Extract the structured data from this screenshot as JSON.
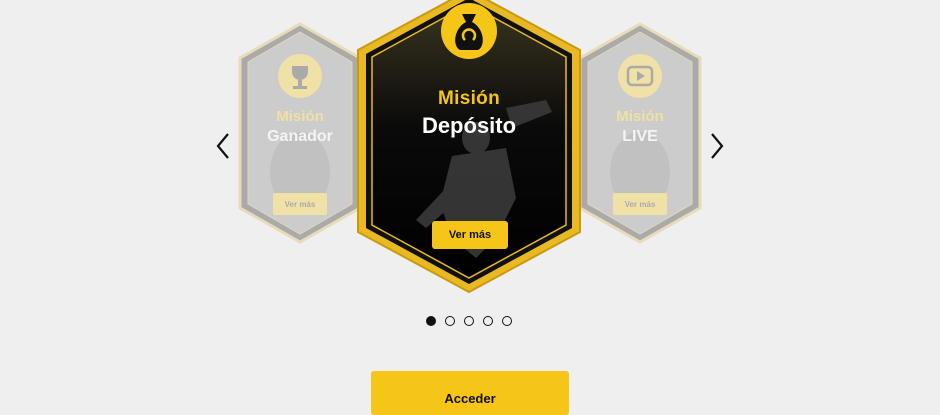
{
  "carousel": {
    "prev_label": "Previous",
    "next_label": "Next",
    "cards": [
      {
        "title_line1": "Misión",
        "title_line2": "Ganador",
        "button_label": "Ver más",
        "icon": "trophy-icon"
      },
      {
        "title_line1": "Misión",
        "title_line2": "Depósito",
        "button_label": "Ver más",
        "icon": "money-bag-icon"
      },
      {
        "title_line1": "Misión",
        "title_line2": "LIVE",
        "button_label": "Ver más",
        "icon": "play-icon"
      }
    ],
    "dots_total": 5,
    "active_dot": 1
  },
  "access_button": {
    "label": "Acceder"
  },
  "colors": {
    "accent": "#f5c518",
    "background": "#efefef",
    "card_dark": "#111111"
  }
}
